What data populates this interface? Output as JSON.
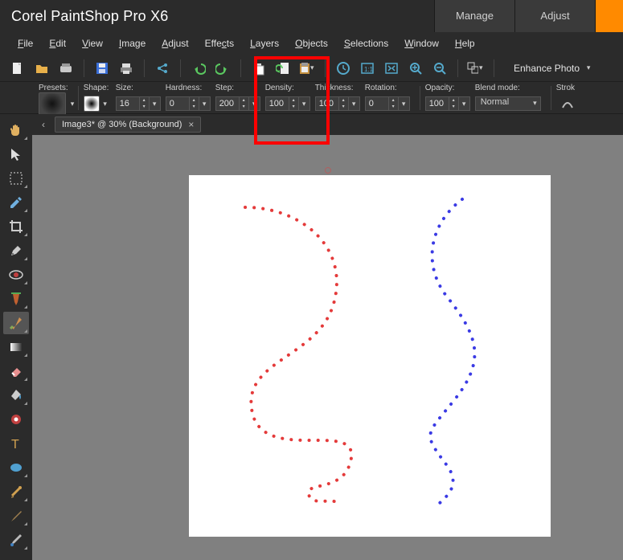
{
  "title": "Corel PaintShop Pro X6",
  "workspace_tabs": {
    "manage": "Manage",
    "adjust": "Adjust"
  },
  "menu": [
    "File",
    "Edit",
    "View",
    "Image",
    "Adjust",
    "Effects",
    "Layers",
    "Objects",
    "Selections",
    "Window",
    "Help"
  ],
  "toolbar": {
    "enhance_label": "Enhance Photo"
  },
  "options": {
    "presets_label": "Presets:",
    "shape_label": "Shape:",
    "size_label": "Size:",
    "size_value": "16",
    "hardness_label": "Hardness:",
    "hardness_value": "0",
    "step_label": "Step:",
    "step_value": "200",
    "density_label": "Density:",
    "density_value": "100",
    "thickness_label": "Thickness:",
    "thickness_value": "100",
    "rotation_label": "Rotation:",
    "rotation_value": "0",
    "opacity_label": "Opacity:",
    "opacity_value": "100",
    "blend_label": "Blend mode:",
    "blend_value": "Normal",
    "stroke_label": "Strok"
  },
  "doc_tab": {
    "label": "Image3*  @  30% (Background)"
  },
  "colors": {
    "stroke_red": "#e43a3a",
    "stroke_blue": "#3a3ae4",
    "highlight_box": "#ff0000"
  }
}
